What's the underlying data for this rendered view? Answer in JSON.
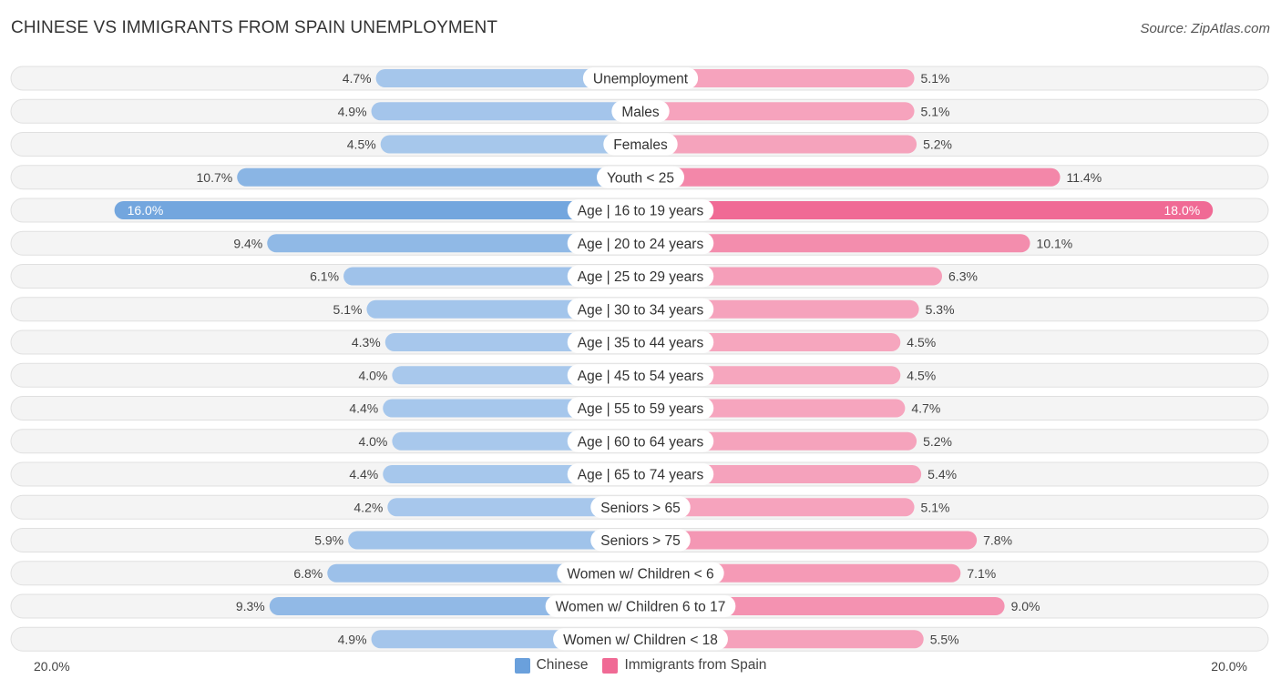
{
  "header": {
    "title": "CHINESE VS IMMIGRANTS FROM SPAIN UNEMPLOYMENT",
    "source": "Source: ZipAtlas.com"
  },
  "colors": {
    "chinese_light": "#a8c8ec",
    "chinese_strong": "#6aa0dc",
    "spain_light": "#f6a8c0",
    "spain_strong": "#f06a95"
  },
  "chart_data": {
    "type": "bar",
    "orientation": "horizontal-diverging",
    "title": "CHINESE VS IMMIGRANTS FROM SPAIN UNEMPLOYMENT",
    "categories": [
      "Unemployment",
      "Males",
      "Females",
      "Youth < 25",
      "Age | 16 to 19 years",
      "Age | 20 to 24 years",
      "Age | 25 to 29 years",
      "Age | 30 to 34 years",
      "Age | 35 to 44 years",
      "Age | 45 to 54 years",
      "Age | 55 to 59 years",
      "Age | 60 to 64 years",
      "Age | 65 to 74 years",
      "Seniors > 65",
      "Seniors > 75",
      "Women w/ Children < 6",
      "Women w/ Children 6 to 17",
      "Women w/ Children < 18"
    ],
    "series": [
      {
        "name": "Chinese",
        "side": "left",
        "values": [
          4.7,
          4.9,
          4.5,
          10.7,
          16.0,
          9.4,
          6.1,
          5.1,
          4.3,
          4.0,
          4.4,
          4.0,
          4.4,
          4.2,
          5.9,
          6.8,
          9.3,
          4.9
        ],
        "labels": [
          "4.7%",
          "4.9%",
          "4.5%",
          "10.7%",
          "16.0%",
          "9.4%",
          "6.1%",
          "5.1%",
          "4.3%",
          "4.0%",
          "4.4%",
          "4.0%",
          "4.4%",
          "4.2%",
          "5.9%",
          "6.8%",
          "9.3%",
          "4.9%"
        ]
      },
      {
        "name": "Immigrants from Spain",
        "side": "right",
        "values": [
          5.1,
          5.1,
          5.2,
          11.4,
          18.0,
          10.1,
          6.3,
          5.3,
          4.5,
          4.5,
          4.7,
          5.2,
          5.4,
          5.1,
          7.8,
          7.1,
          9.0,
          5.5
        ],
        "labels": [
          "5.1%",
          "5.1%",
          "5.2%",
          "11.4%",
          "18.0%",
          "10.1%",
          "6.3%",
          "5.3%",
          "4.5%",
          "4.5%",
          "4.7%",
          "5.2%",
          "5.4%",
          "5.1%",
          "7.8%",
          "7.1%",
          "9.0%",
          "5.5%"
        ]
      }
    ],
    "axis": {
      "left_label": "20.0%",
      "right_label": "20.0%",
      "range": [
        0,
        20
      ]
    },
    "legend": {
      "placement": "bottom-center",
      "items": [
        "Chinese",
        "Immigrants from Spain"
      ]
    },
    "xlabel": "",
    "ylabel": ""
  }
}
